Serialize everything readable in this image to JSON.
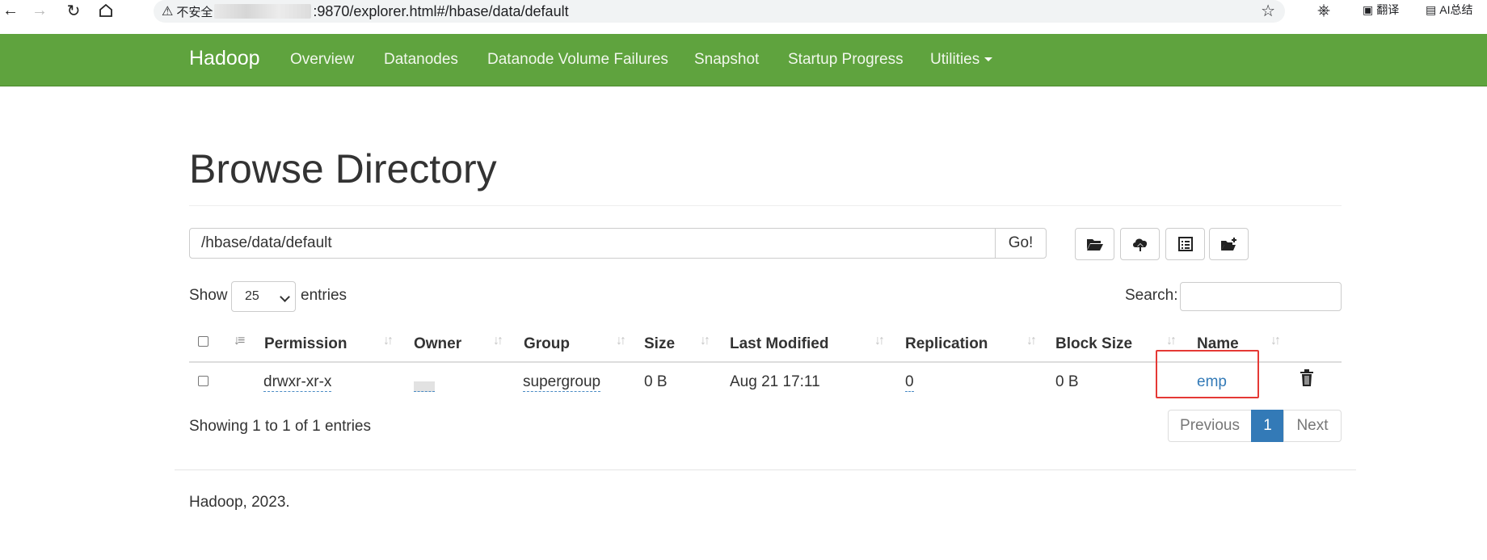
{
  "browser": {
    "security_label": "不安全",
    "url_visible": ":9870/explorer.html#/hbase/data/default",
    "ext_translate": "翻译",
    "ext_ai": "AI总结"
  },
  "navbar": {
    "brand": "Hadoop",
    "items": [
      "Overview",
      "Datanodes",
      "Datanode Volume Failures",
      "Snapshot",
      "Startup Progress",
      "Utilities"
    ],
    "bg_color": "#5fa33e"
  },
  "page": {
    "title": "Browse Directory",
    "path_value": "/hbase/data/default",
    "go_label": "Go!",
    "toolbar_icons": [
      "folder-open-icon",
      "cloud-upload-icon",
      "list-alt-icon",
      "folder-plus-icon"
    ]
  },
  "table_controls": {
    "show_label": "Show",
    "page_length": "25",
    "entries_label": "entries",
    "search_label": "Search:"
  },
  "table": {
    "columns": [
      "Permission",
      "Owner",
      "Group",
      "Size",
      "Last Modified",
      "Replication",
      "Block Size",
      "Name"
    ],
    "rows": [
      {
        "permission": "drwxr-xr-x",
        "owner": "",
        "group": "supergroup",
        "size": "0 B",
        "last_modified": "Aug 21 17:11",
        "replication": "0",
        "block_size": "0 B",
        "name": "emp"
      }
    ]
  },
  "pagination": {
    "info": "Showing 1 to 1 of 1 entries",
    "previous": "Previous",
    "current": "1",
    "next": "Next",
    "active_color": "#337ab7"
  },
  "footer": {
    "text": "Hadoop, 2023."
  }
}
